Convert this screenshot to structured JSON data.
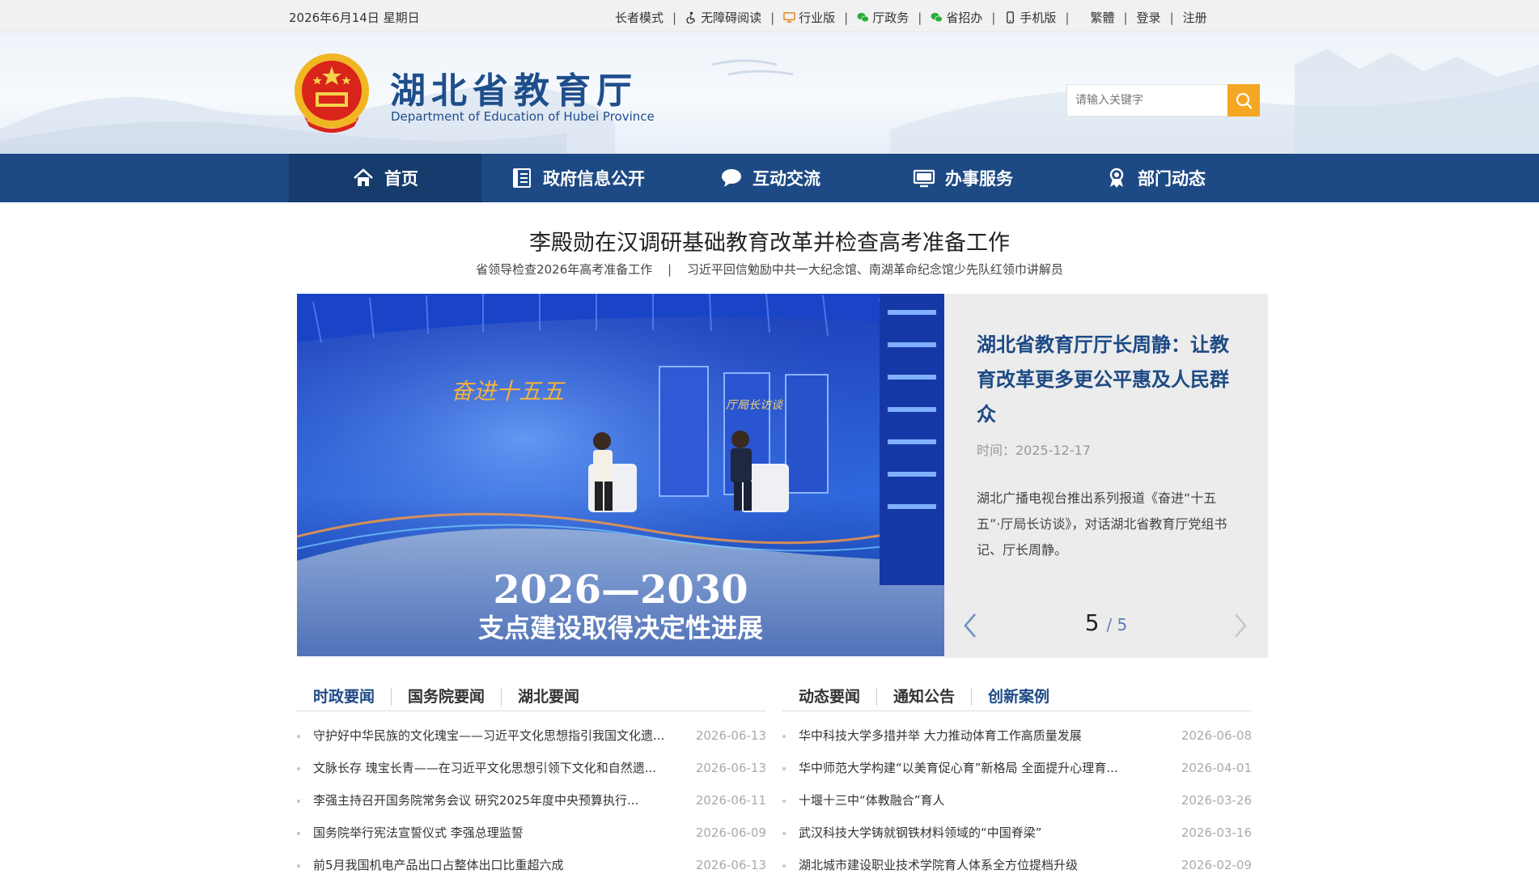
{
  "topbar": {
    "date": "2026年6月14日 星期日",
    "links": [
      {
        "label": "长者模式",
        "icon": "none"
      },
      {
        "label": "无障碍阅读",
        "icon": "accessibility-icon"
      },
      {
        "label": "行业版",
        "icon": "monitor-icon"
      },
      {
        "label": "厅政务",
        "icon": "wechat-icon"
      },
      {
        "label": "省招办",
        "icon": "wechat-icon"
      },
      {
        "label": "手机版",
        "icon": "mobile-icon"
      }
    ],
    "traditional": "繁體",
    "login": "登录",
    "register": "注册"
  },
  "header": {
    "title": "湖北省教育厅",
    "subtitle": "Department of Education of Hubei Province",
    "search_placeholder": "请输入关键字"
  },
  "nav": [
    {
      "label": "首页",
      "icon": "home-icon",
      "active": true
    },
    {
      "label": "政府信息公开",
      "icon": "document-icon",
      "active": false
    },
    {
      "label": "互动交流",
      "icon": "chat-icon",
      "active": false
    },
    {
      "label": "办事服务",
      "icon": "computer-icon",
      "active": false
    },
    {
      "label": "部门动态",
      "icon": "award-icon",
      "active": false
    }
  ],
  "headline": {
    "title": "李殿勋在汉调研基础教育改革并检查高考准备工作",
    "sub1": "省领导检查2026年高考准备工作",
    "sub_sep": "|",
    "sub2": "习近平回信勉励中共一大纪念馆、南湖革命纪念馆少先队红领巾讲解员"
  },
  "slider": {
    "image_text_line1": "2026—2030",
    "image_text_line2": "支点建设取得决定性进展",
    "image_logo1": "奋进十五五",
    "image_logo2": "厅局长访谈",
    "title": "湖北省教育厅厅长周静：让教育改革更多更公平惠及人民群众",
    "date": "时间：2025-12-17",
    "desc": "湖北广播电视台推出系列报道《奋进“十五五”·厅局长访谈》，对话湖北省教育厅党组书记、厅长周静。",
    "current": "5",
    "total": "/ 5"
  },
  "left_news": {
    "tabs": [
      {
        "label": "时政要闻",
        "active": true
      },
      {
        "label": "国务院要闻",
        "active": false
      },
      {
        "label": "湖北要闻",
        "active": false
      }
    ],
    "items": [
      {
        "title": "守护好中华民族的文化瑰宝——习近平文化思想指引我国文化遗...",
        "date": "2026-06-13"
      },
      {
        "title": "文脉长存 瑰宝长青——在习近平文化思想引领下文化和自然遗...",
        "date": "2026-06-13"
      },
      {
        "title": "李强主持召开国务院常务会议 研究2025年度中央预算执行...",
        "date": "2026-06-11"
      },
      {
        "title": "国务院举行宪法宣誓仪式 李强总理监誓",
        "date": "2026-06-09"
      },
      {
        "title": "前5月我国机电产品出口占整体出口比重超六成",
        "date": "2026-06-13"
      }
    ]
  },
  "right_news": {
    "tabs": [
      {
        "label": "动态要闻",
        "active": false
      },
      {
        "label": "通知公告",
        "active": false
      },
      {
        "label": "创新案例",
        "active": true
      }
    ],
    "items": [
      {
        "title": "华中科技大学多措并举 大力推动体育工作高质量发展",
        "date": "2026-06-08"
      },
      {
        "title": "华中师范大学构建“以美育促心育”新格局 全面提升心理育...",
        "date": "2026-04-01"
      },
      {
        "title": "十堰十三中“体教融合”育人",
        "date": "2026-03-26"
      },
      {
        "title": "武汉科技大学铸就钢铁材料领域的“中国脊梁”",
        "date": "2026-03-16"
      },
      {
        "title": "湖北城市建设职业技术学院育人体系全方位提档升级",
        "date": "2026-02-09"
      }
    ]
  },
  "colors": {
    "nav_bg": "#1d4a85",
    "nav_active": "#163b6d",
    "title_blue": "#1f4e8c",
    "search_btn": "#f5a623",
    "panel_bg": "#ececec"
  }
}
